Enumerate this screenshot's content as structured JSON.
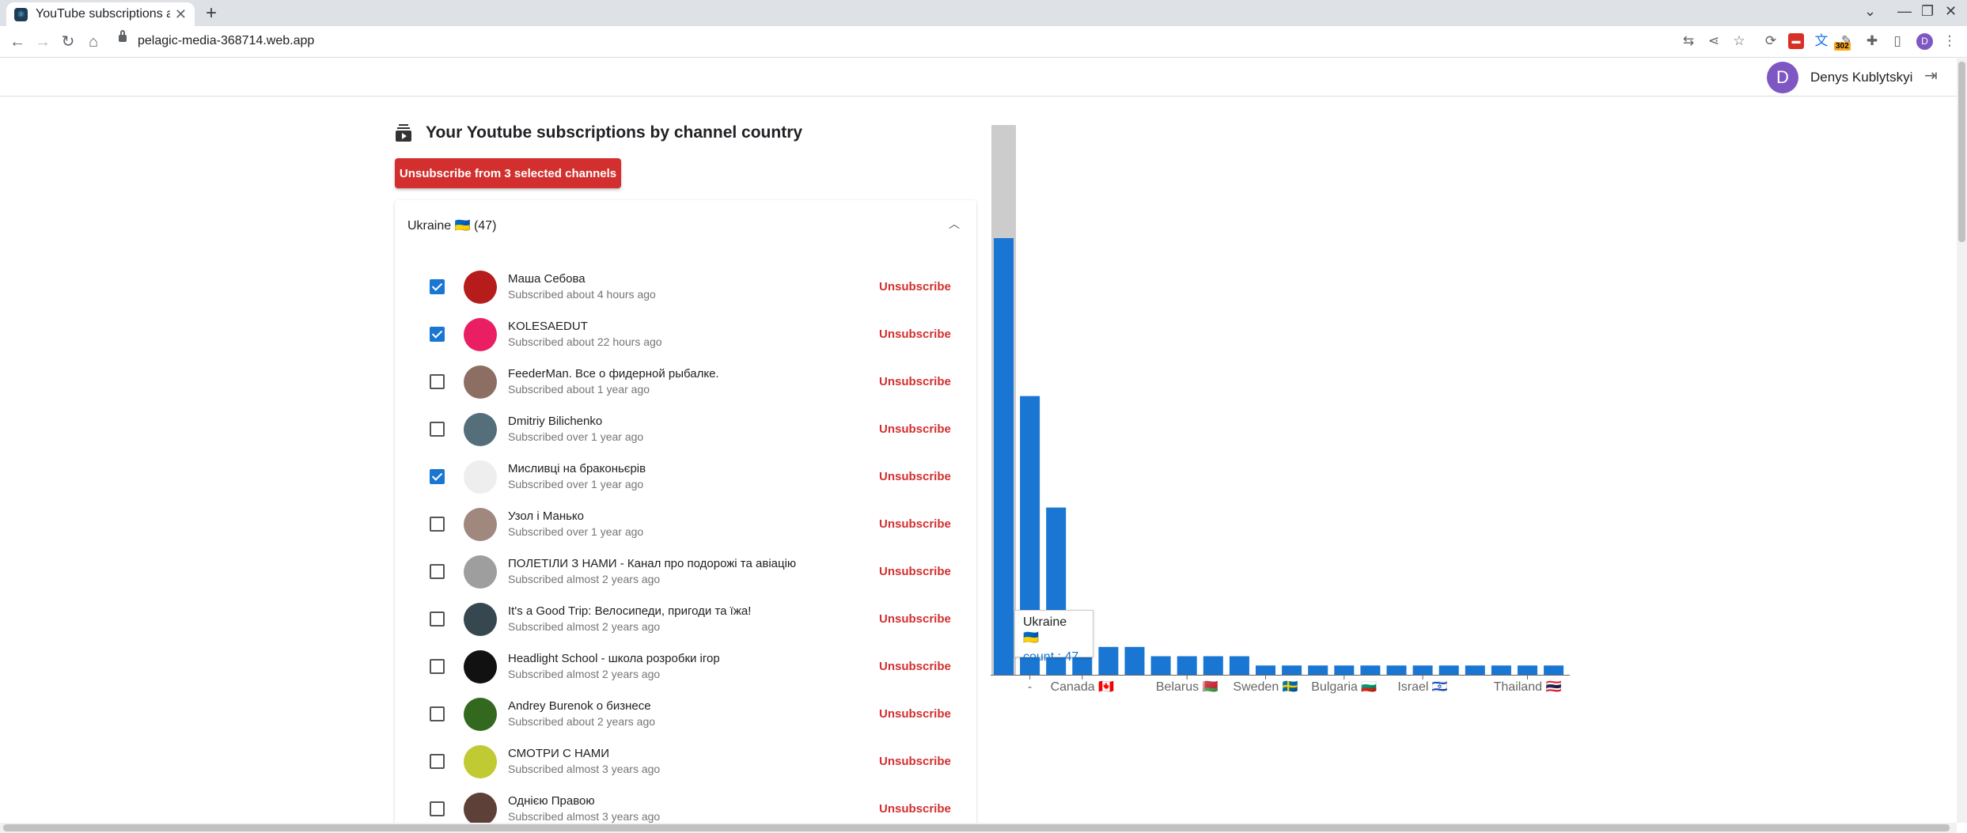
{
  "browser": {
    "tab_title": "YouTube subscriptions a",
    "url": "pelagic-media-368714.web.app",
    "ext_badge": "302",
    "profile_initial": "D",
    "icons": {
      "newtab": "+",
      "close": "✕",
      "back": "←",
      "forward": "→",
      "reload": "↻",
      "home": "⌂",
      "minimize": "—",
      "restore": "❐",
      "winclose": "✕",
      "dropdown": "⌄",
      "translate": "⇆",
      "share": "⋖",
      "star": "☆",
      "menu": "⋮",
      "ext1": "⟳",
      "ext2": "▬",
      "ext3": "文",
      "ext4": "✎",
      "puzzle": "✚",
      "sidepanel": "▯"
    }
  },
  "header": {
    "user_initial": "D",
    "user_name": "Denys Kublytskyi",
    "logout_icon": "⇥"
  },
  "main": {
    "title": "Your Youtube subscriptions by channel country",
    "unsubscribe_selected_label": "Unsubscribe from 3 selected channels",
    "group_label": "Ukraine 🇺🇦 (47)",
    "chevron": "︿",
    "unsubscribe_label": "Unsubscribe",
    "channels": [
      {
        "name": "Маша Себова",
        "subscribed": "Subscribed about 4 hours ago",
        "checked": true,
        "avatar_color": "#b71c1c"
      },
      {
        "name": "KOLESAEDUT",
        "subscribed": "Subscribed about 22 hours ago",
        "checked": true,
        "avatar_color": "#e91e63"
      },
      {
        "name": "FeederMan. Все о фидерной рыбалке.",
        "subscribed": "Subscribed about 1 year ago",
        "checked": false,
        "avatar_color": "#8d6e63"
      },
      {
        "name": "Dmitriy Bilichenko",
        "subscribed": "Subscribed over 1 year ago",
        "checked": false,
        "avatar_color": "#546e7a"
      },
      {
        "name": "Мисливці на браконьєрів",
        "subscribed": "Subscribed over 1 year ago",
        "checked": true,
        "avatar_color": "#eeeeee"
      },
      {
        "name": "Узол і Манько",
        "subscribed": "Subscribed over 1 year ago",
        "checked": false,
        "avatar_color": "#a1887f"
      },
      {
        "name": "ПОЛЕТІЛИ З НАМИ - Канал про подорожі та авіацію",
        "subscribed": "Subscribed almost 2 years ago",
        "checked": false,
        "avatar_color": "#9e9e9e"
      },
      {
        "name": "It's a Good Trip: Велосипеди, пригоди та їжа!",
        "subscribed": "Subscribed almost 2 years ago",
        "checked": false,
        "avatar_color": "#37474f"
      },
      {
        "name": "Headlight School - школа розробки ігор",
        "subscribed": "Subscribed almost 2 years ago",
        "checked": false,
        "avatar_color": "#111111"
      },
      {
        "name": "Andrey Burenok о бизнесе",
        "subscribed": "Subscribed about 2 years ago",
        "checked": false,
        "avatar_color": "#33691e"
      },
      {
        "name": "СМОТРИ С НАМИ",
        "subscribed": "Subscribed almost 3 years ago",
        "checked": false,
        "avatar_color": "#c0ca33"
      },
      {
        "name": "Однією Правою",
        "subscribed": "Subscribed almost 3 years ago",
        "checked": false,
        "avatar_color": "#5d4037"
      }
    ]
  },
  "chart_data": {
    "type": "bar",
    "categories": [
      "Ukraine 🇺🇦",
      "-",
      "",
      "Canada 🇨🇦",
      "",
      "",
      "",
      "Belarus 🇧🇾",
      "",
      "Sweden 🇸🇪",
      "",
      "",
      "Bulgaria 🇧🇬",
      "",
      "",
      "Israel 🇮🇱",
      "",
      "",
      "",
      "",
      "Thailand 🇹🇭",
      ""
    ],
    "values": [
      47,
      30,
      18,
      4,
      3,
      3,
      2,
      2,
      2,
      2,
      1,
      1,
      1,
      1,
      1,
      1,
      1,
      1,
      1,
      1,
      1,
      1
    ],
    "highlighted_index": 0,
    "highlight_color": "#cccccc",
    "bar_color": "#1976d2",
    "tooltip": {
      "label": "Ukraine 🇺🇦",
      "value_text": "count : 47"
    },
    "x_tick_labels": [
      {
        "index": 1,
        "label": "-"
      },
      {
        "index": 3,
        "label": "Canada 🇨🇦"
      },
      {
        "index": 7,
        "label": "Belarus 🇧🇾"
      },
      {
        "index": 10,
        "label": "Sweden 🇸🇪"
      },
      {
        "index": 13,
        "label": "Bulgaria 🇧🇬"
      },
      {
        "index": 16,
        "label": "Israel 🇮🇱"
      },
      {
        "index": 20,
        "label": "Thailand 🇹🇭"
      }
    ]
  }
}
